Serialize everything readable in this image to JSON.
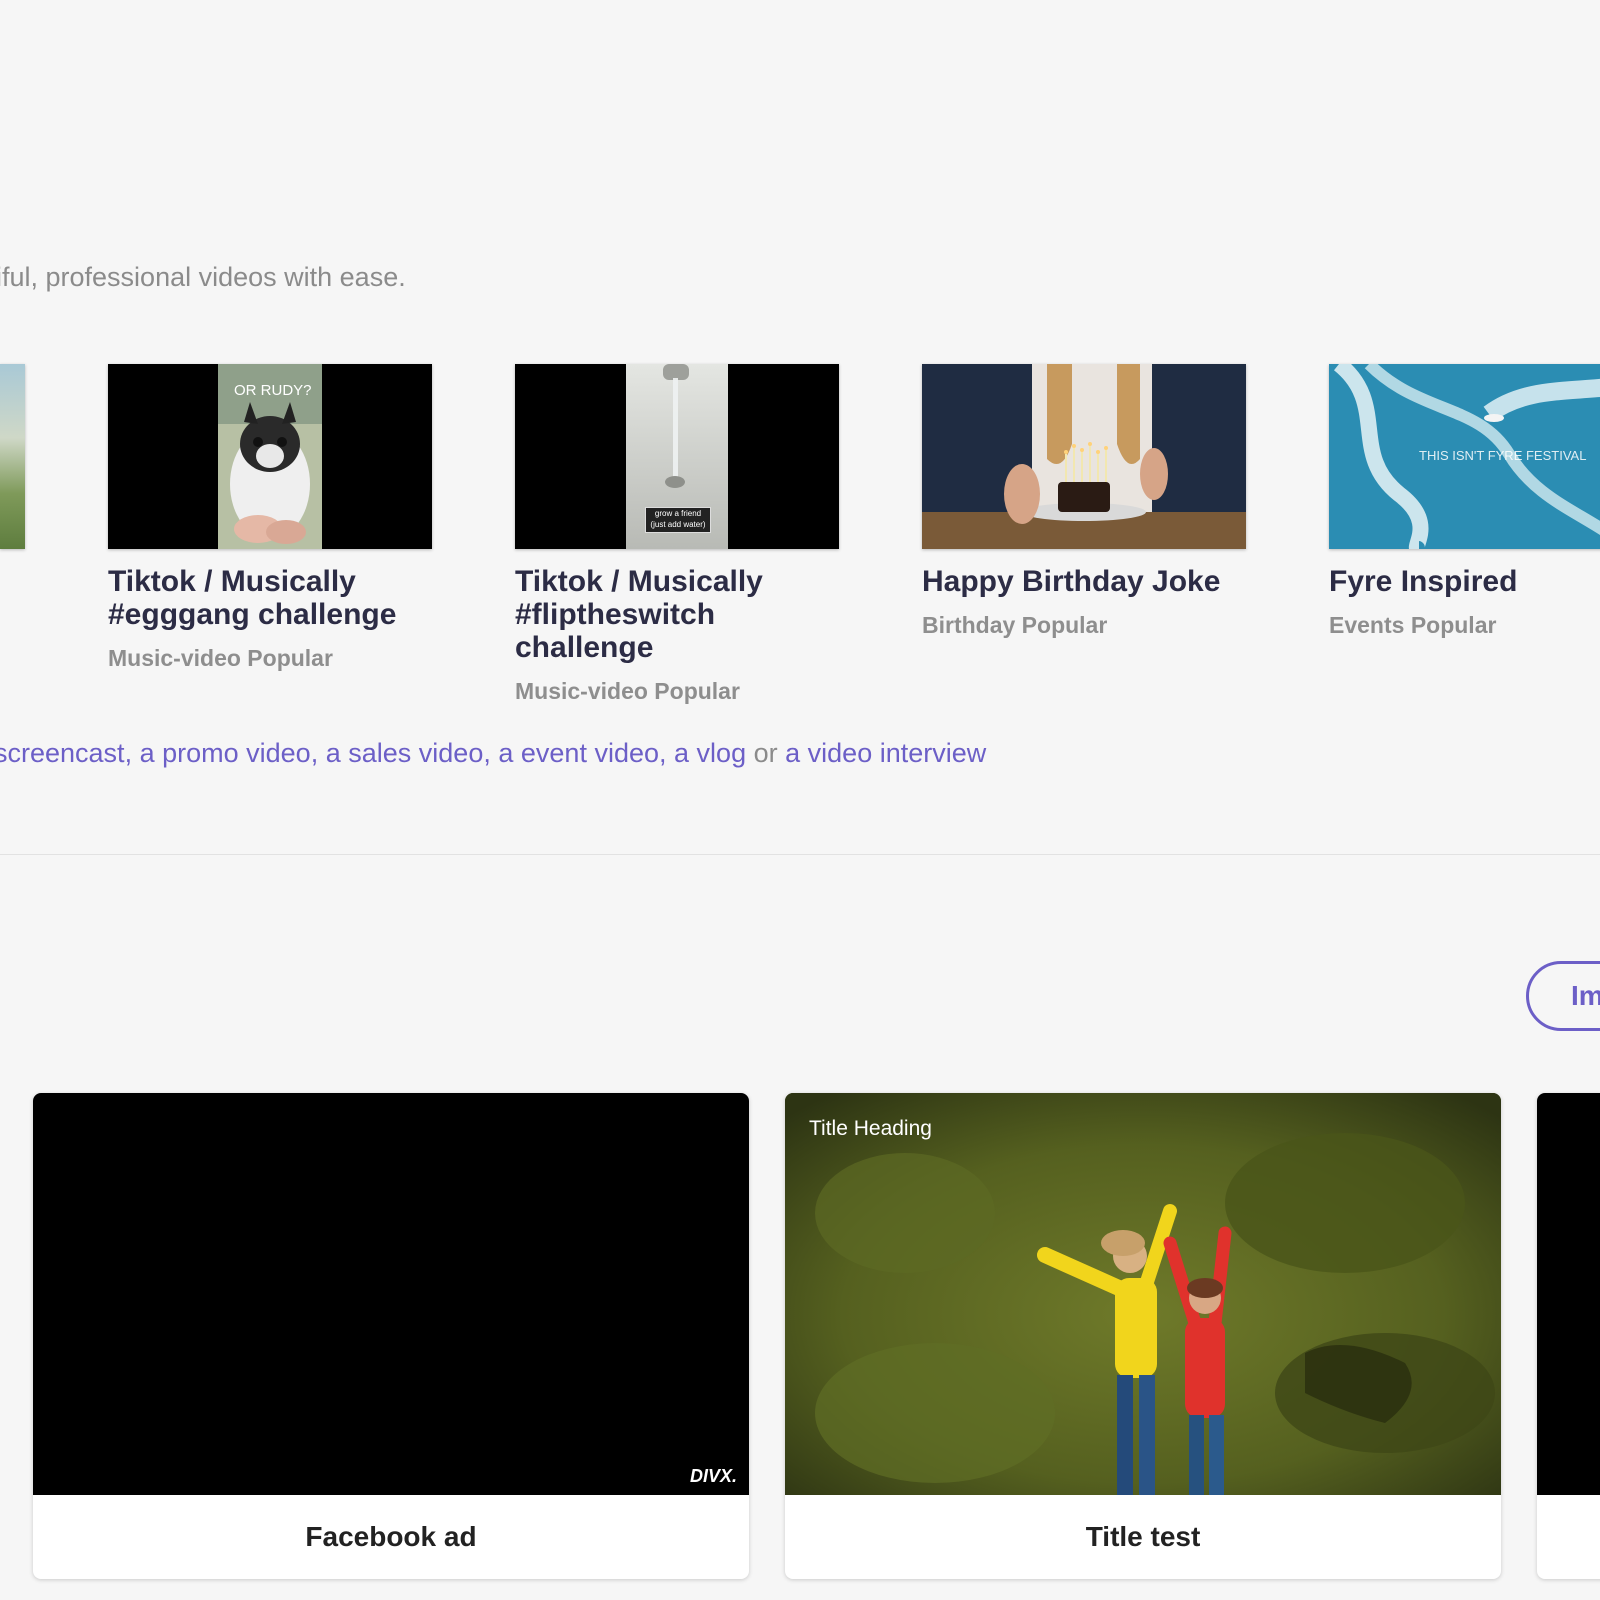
{
  "hero": {
    "subtitle": "iful, professional videos with ease."
  },
  "templates": [
    {
      "title": "Tiktok / Musically #egggang challenge",
      "tags": "Music-video Popular",
      "overlay": "OR RUDY?"
    },
    {
      "title": "Tiktok / Musically #fliptheswitch challenge",
      "tags": "Music-video Popular",
      "overlay_line1": "grow a friend",
      "overlay_line2": "(just add water)"
    },
    {
      "title": "Happy Birthday Joke",
      "tags": "Birthday Popular"
    },
    {
      "title": "Fyre Inspired",
      "tags": "Events Popular",
      "overlay": "THIS ISN'T FYRE FESTIVAL"
    }
  ],
  "links": {
    "items": [
      "screencast",
      "a promo video",
      "a sales video",
      "a event video",
      "a vlog",
      "a video interview"
    ],
    "separator": ",",
    "or": "or"
  },
  "import_button": "Im",
  "projects": [
    {
      "label": "Facebook ad",
      "watermark": "DIVX."
    },
    {
      "label": "Title test",
      "overlay": "Title Heading"
    }
  ],
  "colors": {
    "accent": "#6c5fc7",
    "background": "#f6f6f6",
    "title": "#2c2c45",
    "muted": "#8b8b8b"
  }
}
